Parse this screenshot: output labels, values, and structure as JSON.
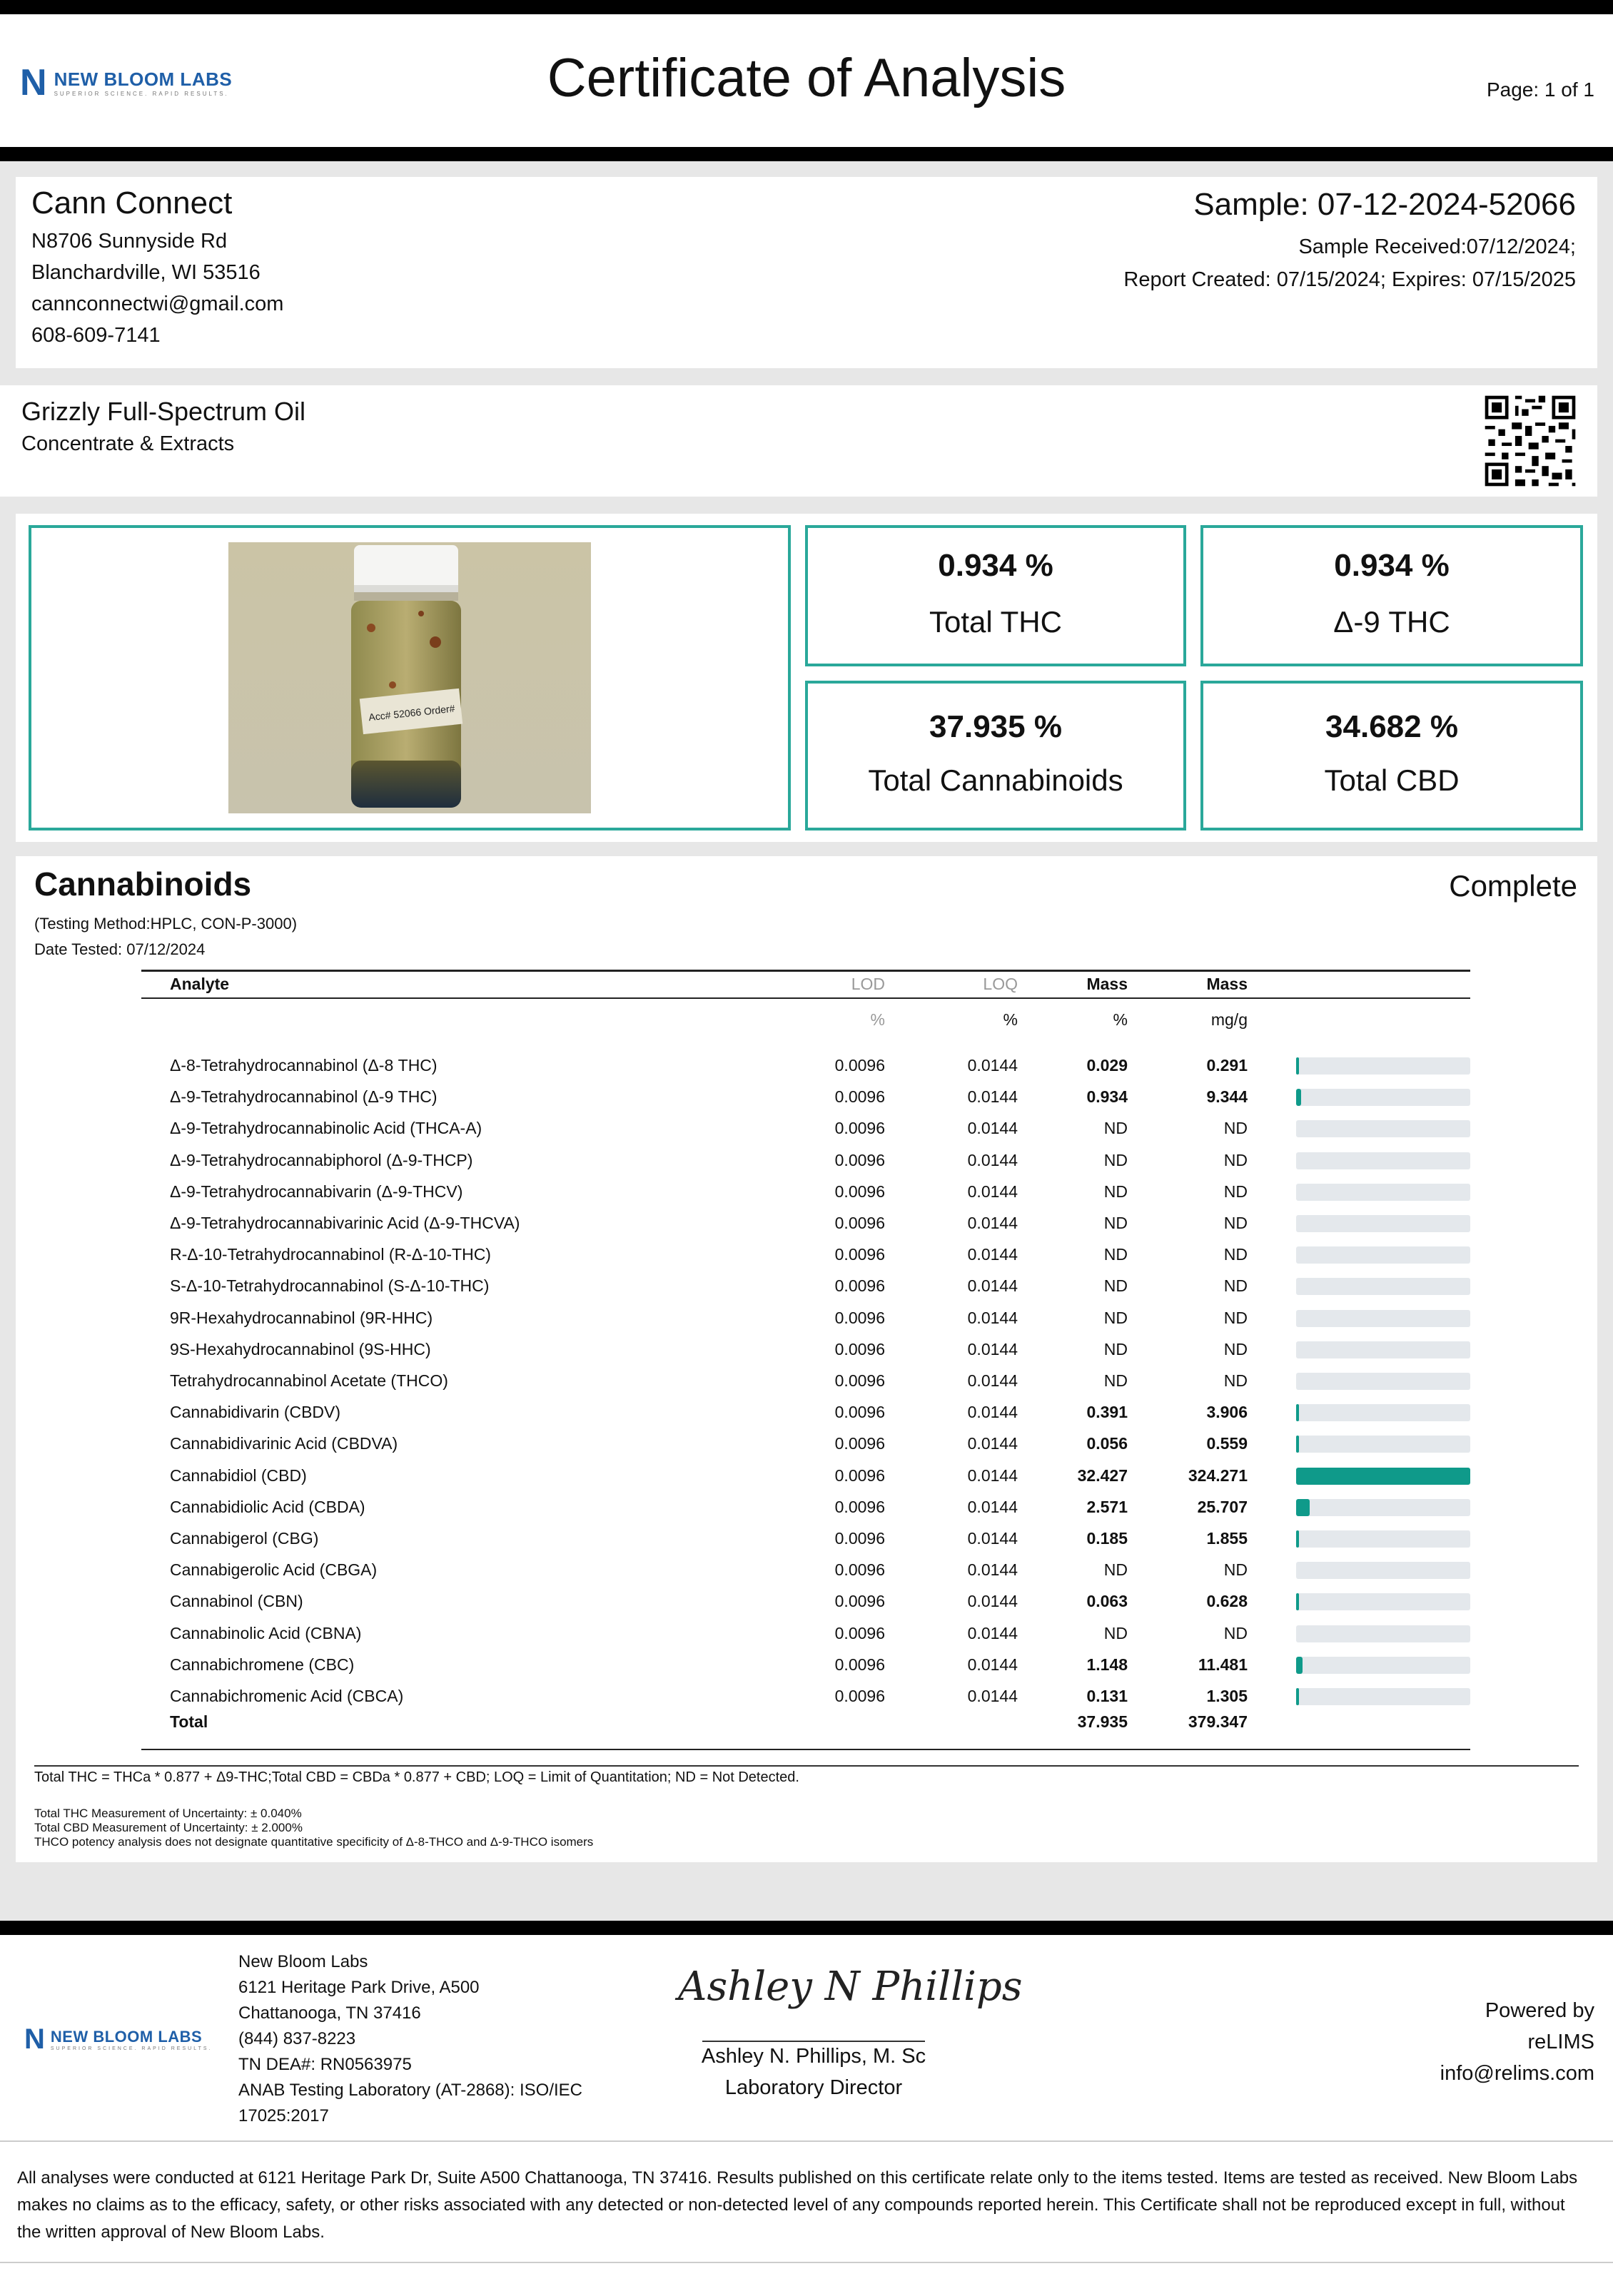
{
  "header": {
    "logo_mark": "N",
    "logo_name": "NEW BLOOM LABS",
    "logo_tagline": "SUPERIOR SCIENCE. RAPID RESULTS.",
    "title": "Certificate of Analysis",
    "page": "Page: 1 of 1"
  },
  "client": {
    "name": "Cann Connect",
    "address1": "N8706 Sunnyside Rd",
    "address2": "Blanchardville, WI 53516",
    "email": "cannconnectwi@gmail.com",
    "phone": "608-609-7141"
  },
  "sample": {
    "id": "Sample: 07-12-2024-52066",
    "received": "Sample Received:07/12/2024;",
    "report": "Report Created: 07/15/2024; Expires: 07/15/2025"
  },
  "product": {
    "name": "Grizzly Full-Spectrum Oil",
    "category": "Concentrate & Extracts"
  },
  "photo": {
    "label": "Acc# 52066  Order#"
  },
  "summary": [
    {
      "value": "0.934 %",
      "label": "Total THC"
    },
    {
      "value": "0.934 %",
      "label": "Δ-9 THC"
    },
    {
      "value": "37.935 %",
      "label": "Total Cannabinoids"
    },
    {
      "value": "34.682 %",
      "label": "Total CBD"
    }
  ],
  "cannabinoids": {
    "title": "Cannabinoids",
    "status": "Complete",
    "method": "(Testing Method:HPLC, CON-P-3000)",
    "date_tested": "Date Tested: 07/12/2024",
    "columns": [
      "Analyte",
      "LOD",
      "LOQ",
      "Mass",
      "Mass"
    ],
    "units": [
      "%",
      "%",
      "%",
      "mg/g"
    ],
    "rows": [
      {
        "analyte": "Δ-8-Tetrahydrocannabinol (Δ-8 THC)",
        "lod": "0.0096",
        "loq": "0.0144",
        "pct": "0.029",
        "mg": "0.291",
        "fraction": 0.0009
      },
      {
        "analyte": "Δ-9-Tetrahydrocannabinol (Δ-9 THC)",
        "lod": "0.0096",
        "loq": "0.0144",
        "pct": "0.934",
        "mg": "9.344",
        "fraction": 0.029
      },
      {
        "analyte": "Δ-9-Tetrahydrocannabinolic Acid (THCA-A)",
        "lod": "0.0096",
        "loq": "0.0144",
        "pct": "ND",
        "mg": "ND",
        "fraction": 0
      },
      {
        "analyte": "Δ-9-Tetrahydrocannabiphorol (Δ-9-THCP)",
        "lod": "0.0096",
        "loq": "0.0144",
        "pct": "ND",
        "mg": "ND",
        "fraction": 0
      },
      {
        "analyte": "Δ-9-Tetrahydrocannabivarin (Δ-9-THCV)",
        "lod": "0.0096",
        "loq": "0.0144",
        "pct": "ND",
        "mg": "ND",
        "fraction": 0
      },
      {
        "analyte": "Δ-9-Tetrahydrocannabivarinic Acid (Δ-9-THCVA)",
        "lod": "0.0096",
        "loq": "0.0144",
        "pct": "ND",
        "mg": "ND",
        "fraction": 0
      },
      {
        "analyte": "R-Δ-10-Tetrahydrocannabinol (R-Δ-10-THC)",
        "lod": "0.0096",
        "loq": "0.0144",
        "pct": "ND",
        "mg": "ND",
        "fraction": 0
      },
      {
        "analyte": "S-Δ-10-Tetrahydrocannabinol (S-Δ-10-THC)",
        "lod": "0.0096",
        "loq": "0.0144",
        "pct": "ND",
        "mg": "ND",
        "fraction": 0
      },
      {
        "analyte": "9R-Hexahydrocannabinol (9R-HHC)",
        "lod": "0.0096",
        "loq": "0.0144",
        "pct": "ND",
        "mg": "ND",
        "fraction": 0
      },
      {
        "analyte": "9S-Hexahydrocannabinol (9S-HHC)",
        "lod": "0.0096",
        "loq": "0.0144",
        "pct": "ND",
        "mg": "ND",
        "fraction": 0
      },
      {
        "analyte": "Tetrahydrocannabinol Acetate (THCO)",
        "lod": "0.0096",
        "loq": "0.0144",
        "pct": "ND",
        "mg": "ND",
        "fraction": 0
      },
      {
        "analyte": "Cannabidivarin (CBDV)",
        "lod": "0.0096",
        "loq": "0.0144",
        "pct": "0.391",
        "mg": "3.906",
        "fraction": 0.012
      },
      {
        "analyte": "Cannabidivarinic Acid (CBDVA)",
        "lod": "0.0096",
        "loq": "0.0144",
        "pct": "0.056",
        "mg": "0.559",
        "fraction": 0.0017
      },
      {
        "analyte": "Cannabidiol (CBD)",
        "lod": "0.0096",
        "loq": "0.0144",
        "pct": "32.427",
        "mg": "324.271",
        "fraction": 1.0
      },
      {
        "analyte": "Cannabidiolic Acid (CBDA)",
        "lod": "0.0096",
        "loq": "0.0144",
        "pct": "2.571",
        "mg": "25.707",
        "fraction": 0.079
      },
      {
        "analyte": "Cannabigerol (CBG)",
        "lod": "0.0096",
        "loq": "0.0144",
        "pct": "0.185",
        "mg": "1.855",
        "fraction": 0.0057
      },
      {
        "analyte": "Cannabigerolic Acid (CBGA)",
        "lod": "0.0096",
        "loq": "0.0144",
        "pct": "ND",
        "mg": "ND",
        "fraction": 0
      },
      {
        "analyte": "Cannabinol (CBN)",
        "lod": "0.0096",
        "loq": "0.0144",
        "pct": "0.063",
        "mg": "0.628",
        "fraction": 0.0019
      },
      {
        "analyte": "Cannabinolic Acid (CBNA)",
        "lod": "0.0096",
        "loq": "0.0144",
        "pct": "ND",
        "mg": "ND",
        "fraction": 0
      },
      {
        "analyte": "Cannabichromene (CBC)",
        "lod": "0.0096",
        "loq": "0.0144",
        "pct": "1.148",
        "mg": "11.481",
        "fraction": 0.035
      },
      {
        "analyte": "Cannabichromenic Acid (CBCA)",
        "lod": "0.0096",
        "loq": "0.0144",
        "pct": "0.131",
        "mg": "1.305",
        "fraction": 0.004
      }
    ],
    "total": {
      "label": "Total",
      "pct": "37.935",
      "mg": "379.347"
    },
    "note": "Total THC = THCa * 0.877 + Δ9-THC;Total CBD = CBDa * 0.877 + CBD; LOQ = Limit of Quantitation; ND = Not Detected.",
    "uncertainty_thc": "Total THC Measurement of Uncertainty: ± 0.040%",
    "uncertainty_cbd": "Total CBD Measurement of Uncertainty: ± 2.000%",
    "thco_note": "THCO potency analysis does not designate quantitative specificity of Δ-8-THCO and Δ-9-THCO isomers"
  },
  "lab": {
    "name": "New Bloom Labs",
    "address1": "6121 Heritage Park Drive, A500",
    "address2": "Chattanooga, TN 37416",
    "phone": "(844) 837-8223",
    "dea": "TN DEA#: RN0563975",
    "anab1": "ANAB Testing Laboratory (AT-2868): ISO/IEC",
    "anab2": "17025:2017"
  },
  "signature": {
    "script": "Ashley N Phillips",
    "name": "Ashley N. Phillips, M. Sc",
    "title": "Laboratory Director"
  },
  "powered": {
    "line1": "Powered by",
    "line2": "reLIMS",
    "email": "info@relims.com"
  },
  "disclaimer": "All analyses were conducted at 6121 Heritage Park Dr, Suite A500 Chattanooga, TN 37416. Results published on this certificate relate only to the items tested. Items are tested as received. New Bloom Labs makes no claims as to the efficacy, safety, or other risks associated with any detected or non-detected level of any compounds reported herein. This Certificate shall not be reproduced except in full, without the written approval of New Bloom Labs.",
  "colors": {
    "accent": "#2aa89a",
    "bar": "#0f9a8a",
    "brand": "#1f5fa8"
  }
}
